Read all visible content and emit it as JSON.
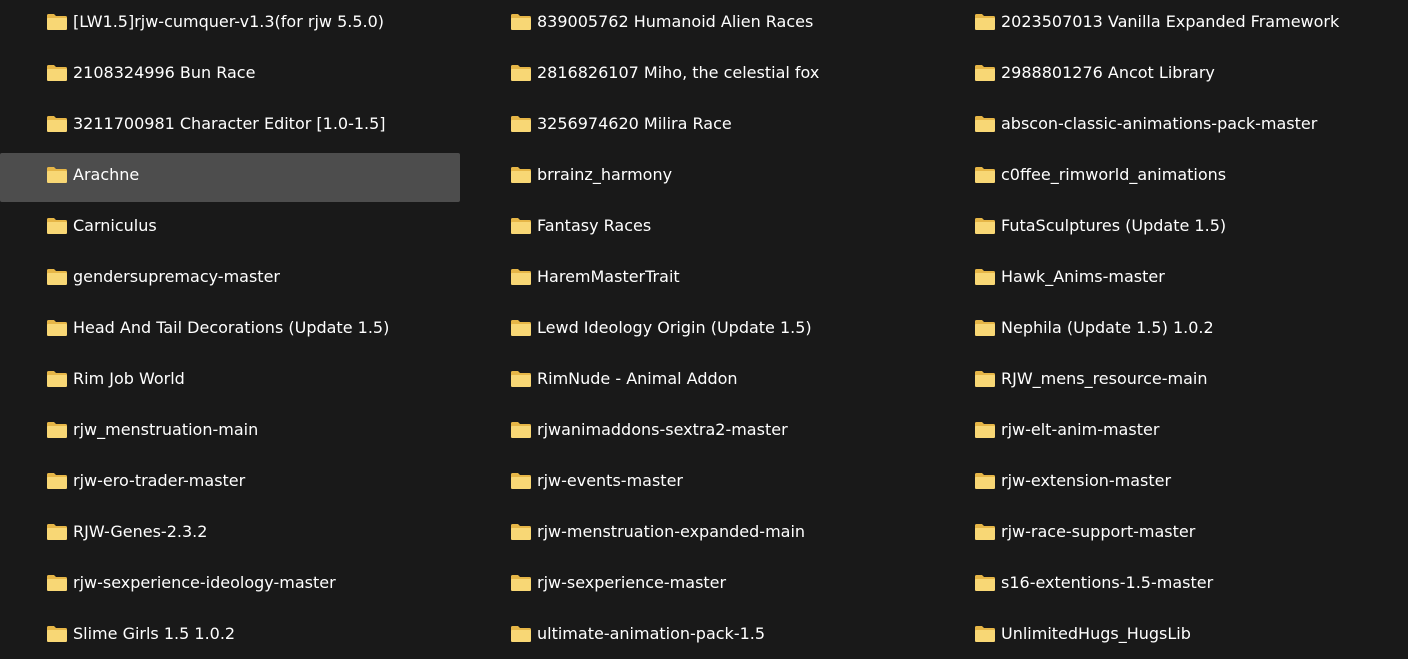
{
  "colors": {
    "background": "#191919",
    "selected_background": "#4d4d4d",
    "text": "#ffffff",
    "folder_front": "#f8d775",
    "folder_back": "#e6b647"
  },
  "icon": "folder-icon",
  "columns": [
    {
      "items": [
        {
          "label": "[LW1.5]rjw-cumquer-v1.3(for rjw 5.5.0)",
          "selected": false
        },
        {
          "label": "2108324996 Bun Race",
          "selected": false
        },
        {
          "label": "3211700981 Character Editor [1.0-1.5]",
          "selected": false
        },
        {
          "label": "Arachne",
          "selected": true
        },
        {
          "label": "Carniculus",
          "selected": false
        },
        {
          "label": "gendersupremacy-master",
          "selected": false
        },
        {
          "label": "Head And Tail Decorations (Update 1.5)",
          "selected": false
        },
        {
          "label": "Rim Job World",
          "selected": false
        },
        {
          "label": "rjw_menstruation-main",
          "selected": false
        },
        {
          "label": "rjw-ero-trader-master",
          "selected": false
        },
        {
          "label": "RJW-Genes-2.3.2",
          "selected": false
        },
        {
          "label": "rjw-sexperience-ideology-master",
          "selected": false
        },
        {
          "label": "Slime Girls 1.5 1.0.2",
          "selected": false
        }
      ]
    },
    {
      "items": [
        {
          "label": "839005762 Humanoid Alien Races",
          "selected": false
        },
        {
          "label": "2816826107 Miho, the celestial fox",
          "selected": false
        },
        {
          "label": "3256974620 Milira Race",
          "selected": false
        },
        {
          "label": "brrainz_harmony",
          "selected": false
        },
        {
          "label": "Fantasy Races",
          "selected": false
        },
        {
          "label": "HaremMasterTrait",
          "selected": false
        },
        {
          "label": "Lewd Ideology Origin (Update 1.5)",
          "selected": false
        },
        {
          "label": "RimNude - Animal Addon",
          "selected": false
        },
        {
          "label": "rjwanimaddons-sextra2-master",
          "selected": false
        },
        {
          "label": "rjw-events-master",
          "selected": false
        },
        {
          "label": "rjw-menstruation-expanded-main",
          "selected": false
        },
        {
          "label": "rjw-sexperience-master",
          "selected": false
        },
        {
          "label": "ultimate-animation-pack-1.5",
          "selected": false
        }
      ]
    },
    {
      "items": [
        {
          "label": "2023507013 Vanilla Expanded Framework",
          "selected": false
        },
        {
          "label": "2988801276 Ancot Library",
          "selected": false
        },
        {
          "label": "abscon-classic-animations-pack-master",
          "selected": false
        },
        {
          "label": "c0ffee_rimworld_animations",
          "selected": false
        },
        {
          "label": "FutaSculptures (Update 1.5)",
          "selected": false
        },
        {
          "label": "Hawk_Anims-master",
          "selected": false
        },
        {
          "label": "Nephila (Update 1.5) 1.0.2",
          "selected": false
        },
        {
          "label": "RJW_mens_resource-main",
          "selected": false
        },
        {
          "label": "rjw-elt-anim-master",
          "selected": false
        },
        {
          "label": "rjw-extension-master",
          "selected": false
        },
        {
          "label": "rjw-race-support-master",
          "selected": false
        },
        {
          "label": "s16-extentions-1.5-master",
          "selected": false
        },
        {
          "label": "UnlimitedHugs_HugsLib",
          "selected": false
        }
      ]
    }
  ]
}
